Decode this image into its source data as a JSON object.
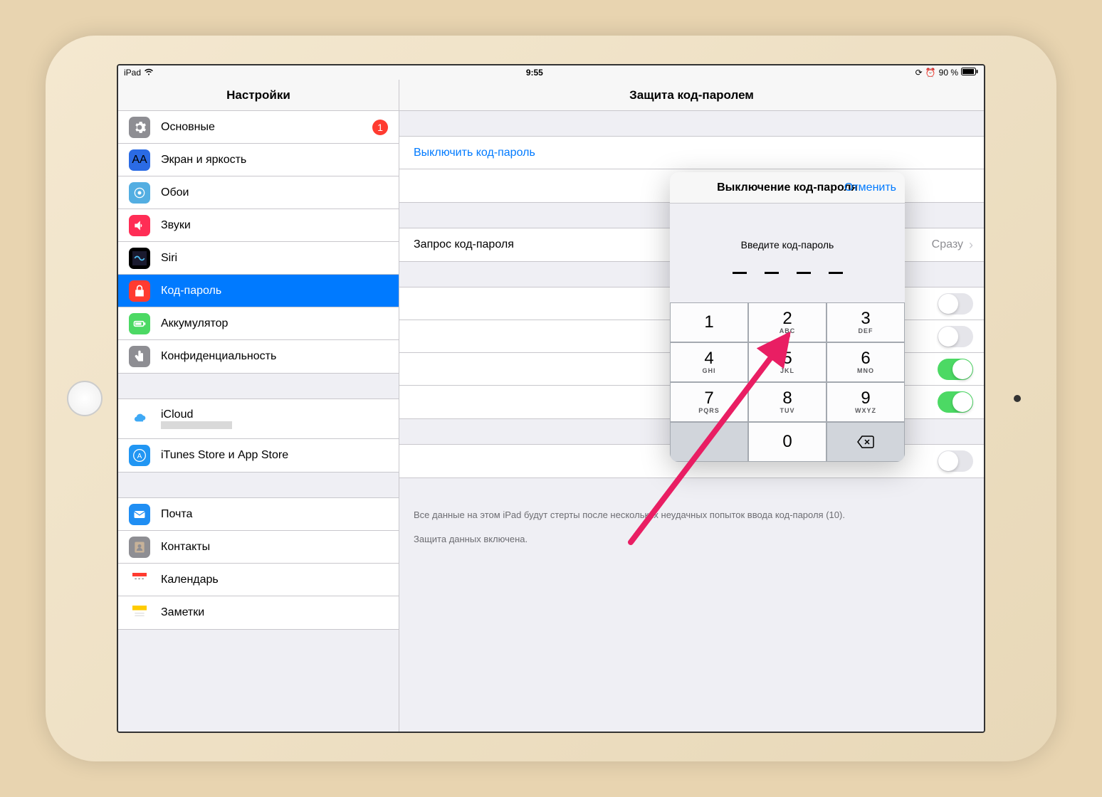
{
  "status": {
    "device": "iPad",
    "time": "9:55",
    "battery_pct": "90 %"
  },
  "sidebar": {
    "title": "Настройки",
    "groups": [
      [
        {
          "label": "Основные",
          "icon": "gear",
          "color": "#8e8e93",
          "badge": "1"
        },
        {
          "label": "Экран и яркость",
          "icon": "brightness",
          "color": "#2b6be4"
        },
        {
          "label": "Обои",
          "icon": "wallpaper",
          "color": "#53aee2"
        },
        {
          "label": "Звуки",
          "icon": "speaker",
          "color": "#ff2d55"
        },
        {
          "label": "Siri",
          "icon": "siri",
          "color": "#000"
        },
        {
          "label": "Код-пароль",
          "icon": "lock",
          "color": "#ff3b30",
          "selected": true
        },
        {
          "label": "Аккумулятор",
          "icon": "battery",
          "color": "#4cd964"
        },
        {
          "label": "Конфиденциальность",
          "icon": "hand",
          "color": "#8e8e93"
        }
      ],
      [
        {
          "label": "iCloud",
          "icon": "cloud",
          "color": "#fff",
          "tall": true,
          "redacted_sub": true
        },
        {
          "label": "iTunes Store и App Store",
          "icon": "appstore",
          "color": "#2196f3"
        }
      ],
      [
        {
          "label": "Почта",
          "icon": "mail",
          "color": "#1f8ef3"
        },
        {
          "label": "Контакты",
          "icon": "contacts",
          "color": "#8e8e93"
        },
        {
          "label": "Календарь",
          "icon": "calendar",
          "color": "#fff"
        },
        {
          "label": "Заметки",
          "icon": "notes",
          "color": "#fff"
        }
      ]
    ]
  },
  "detail": {
    "title": "Защита код-паролем",
    "turn_off": "Выключить код-пароль",
    "require_label": "Запрос код-пароля",
    "require_value": "Сразу",
    "toggles": [
      false,
      false,
      true,
      true,
      false
    ],
    "footer1": "Все данные на этом iPad будут стерты после нескольких неудачных попыток ввода код-пароля (10).",
    "footer2": "Защита данных включена."
  },
  "modal": {
    "title": "Выключение код-пароля",
    "cancel": "Отменить",
    "prompt": "Введите код-пароль",
    "keys": [
      {
        "d": "1",
        "l": ""
      },
      {
        "d": "2",
        "l": "ABC"
      },
      {
        "d": "3",
        "l": "DEF"
      },
      {
        "d": "4",
        "l": "GHI"
      },
      {
        "d": "5",
        "l": "JKL"
      },
      {
        "d": "6",
        "l": "MNO"
      },
      {
        "d": "7",
        "l": "PQRS"
      },
      {
        "d": "8",
        "l": "TUV"
      },
      {
        "d": "9",
        "l": "WXYZ"
      },
      {
        "d": "",
        "l": "",
        "t": "empty"
      },
      {
        "d": "0",
        "l": ""
      },
      {
        "d": "",
        "l": "",
        "t": "backspace"
      }
    ]
  }
}
